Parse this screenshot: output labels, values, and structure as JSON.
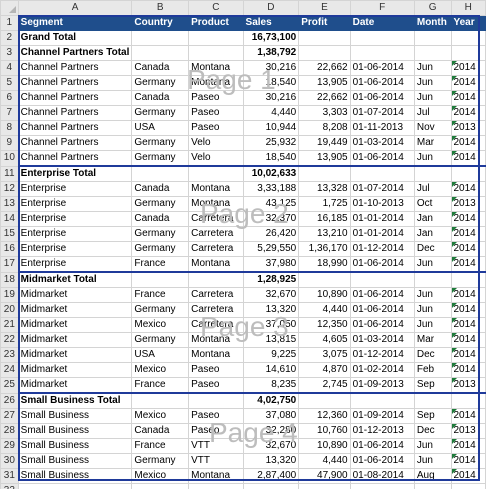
{
  "columns": [
    "A",
    "B",
    "C",
    "D",
    "E",
    "F",
    "G",
    "H"
  ],
  "header": [
    "Segment",
    "Country",
    "Product",
    "Sales",
    "Profit",
    "Date",
    "Month",
    "Year"
  ],
  "rows": [
    {
      "n": "2",
      "type": "total",
      "cells": [
        "Grand Total",
        "",
        "",
        "16,73,100",
        "",
        "",
        "",
        ""
      ]
    },
    {
      "n": "3",
      "type": "total",
      "cells": [
        "Channel Partners Total",
        "",
        "",
        "1,38,792",
        "",
        "",
        "",
        ""
      ]
    },
    {
      "n": "4",
      "type": "data",
      "cells": [
        "Channel Partners",
        "Canada",
        "Montana",
        "30,216",
        "22,662",
        "01-06-2014",
        "Jun",
        "2014"
      ]
    },
    {
      "n": "5",
      "type": "data",
      "cells": [
        "Channel Partners",
        "Germany",
        "Montana",
        "18,540",
        "13,905",
        "01-06-2014",
        "Jun",
        "2014"
      ]
    },
    {
      "n": "6",
      "type": "data",
      "cells": [
        "Channel Partners",
        "Canada",
        "Paseo",
        "30,216",
        "22,662",
        "01-06-2014",
        "Jun",
        "2014"
      ]
    },
    {
      "n": "7",
      "type": "data",
      "cells": [
        "Channel Partners",
        "Germany",
        "Paseo",
        "4,440",
        "3,303",
        "01-07-2014",
        "Jul",
        "2014"
      ]
    },
    {
      "n": "8",
      "type": "data",
      "cells": [
        "Channel Partners",
        "USA",
        "Paseo",
        "10,944",
        "8,208",
        "01-11-2013",
        "Nov",
        "2013"
      ]
    },
    {
      "n": "9",
      "type": "data",
      "cells": [
        "Channel Partners",
        "Germany",
        "Velo",
        "25,932",
        "19,449",
        "01-03-2014",
        "Mar",
        "2014"
      ]
    },
    {
      "n": "10",
      "type": "data",
      "cells": [
        "Channel Partners",
        "Germany",
        "Velo",
        "18,540",
        "13,905",
        "01-06-2014",
        "Jun",
        "2014"
      ]
    },
    {
      "n": "11",
      "type": "total",
      "cells": [
        "Enterprise Total",
        "",
        "",
        "10,02,633",
        "",
        "",
        "",
        ""
      ]
    },
    {
      "n": "12",
      "type": "data",
      "cells": [
        "Enterprise",
        "Canada",
        "Montana",
        "3,33,188",
        "13,328",
        "01-07-2014",
        "Jul",
        "2014"
      ]
    },
    {
      "n": "13",
      "type": "data",
      "cells": [
        "Enterprise",
        "Germany",
        "Montana",
        "43,125",
        "1,725",
        "01-10-2013",
        "Oct",
        "2013"
      ]
    },
    {
      "n": "14",
      "type": "data",
      "cells": [
        "Enterprise",
        "Canada",
        "Carretera",
        "32,370",
        "16,185",
        "01-01-2014",
        "Jan",
        "2014"
      ]
    },
    {
      "n": "15",
      "type": "data",
      "cells": [
        "Enterprise",
        "Germany",
        "Carretera",
        "26,420",
        "13,210",
        "01-01-2014",
        "Jan",
        "2014"
      ]
    },
    {
      "n": "16",
      "type": "data",
      "cells": [
        "Enterprise",
        "Germany",
        "Carretera",
        "5,29,550",
        "1,36,170",
        "01-12-2014",
        "Dec",
        "2014"
      ]
    },
    {
      "n": "17",
      "type": "data",
      "cells": [
        "Enterprise",
        "France",
        "Montana",
        "37,980",
        "18,990",
        "01-06-2014",
        "Jun",
        "2014"
      ]
    },
    {
      "n": "18",
      "type": "total",
      "cells": [
        "Midmarket Total",
        "",
        "",
        "1,28,925",
        "",
        "",
        "",
        ""
      ]
    },
    {
      "n": "19",
      "type": "data",
      "cells": [
        "Midmarket",
        "France",
        "Carretera",
        "32,670",
        "10,890",
        "01-06-2014",
        "Jun",
        "2014"
      ]
    },
    {
      "n": "20",
      "type": "data",
      "cells": [
        "Midmarket",
        "Germany",
        "Carretera",
        "13,320",
        "4,440",
        "01-06-2014",
        "Jun",
        "2014"
      ]
    },
    {
      "n": "21",
      "type": "data",
      "cells": [
        "Midmarket",
        "Mexico",
        "Carretera",
        "37,050",
        "12,350",
        "01-06-2014",
        "Jun",
        "2014"
      ]
    },
    {
      "n": "22",
      "type": "data",
      "cells": [
        "Midmarket",
        "Germany",
        "Montana",
        "13,815",
        "4,605",
        "01-03-2014",
        "Mar",
        "2014"
      ]
    },
    {
      "n": "23",
      "type": "data",
      "cells": [
        "Midmarket",
        "USA",
        "Montana",
        "9,225",
        "3,075",
        "01-12-2014",
        "Dec",
        "2014"
      ]
    },
    {
      "n": "24",
      "type": "data",
      "cells": [
        "Midmarket",
        "Mexico",
        "Paseo",
        "14,610",
        "4,870",
        "01-02-2014",
        "Feb",
        "2014"
      ]
    },
    {
      "n": "25",
      "type": "data",
      "cells": [
        "Midmarket",
        "France",
        "Paseo",
        "8,235",
        "2,745",
        "01-09-2013",
        "Sep",
        "2013"
      ]
    },
    {
      "n": "26",
      "type": "total",
      "cells": [
        "Small Business Total",
        "",
        "",
        "4,02,750",
        "",
        "",
        "",
        ""
      ]
    },
    {
      "n": "27",
      "type": "data",
      "cells": [
        "Small Business",
        "Mexico",
        "Paseo",
        "37,080",
        "12,360",
        "01-09-2014",
        "Sep",
        "2014"
      ]
    },
    {
      "n": "28",
      "type": "data",
      "cells": [
        "Small Business",
        "Canada",
        "Paseo",
        "32,280",
        "10,760",
        "01-12-2013",
        "Dec",
        "2013"
      ]
    },
    {
      "n": "29",
      "type": "data",
      "cells": [
        "Small Business",
        "France",
        "VTT",
        "32,670",
        "10,890",
        "01-06-2014",
        "Jun",
        "2014"
      ]
    },
    {
      "n": "30",
      "type": "data",
      "cells": [
        "Small Business",
        "Germany",
        "VTT",
        "13,320",
        "4,440",
        "01-06-2014",
        "Jun",
        "2014"
      ]
    },
    {
      "n": "31",
      "type": "data",
      "cells": [
        "Small Business",
        "Mexico",
        "Montana",
        "2,87,400",
        "47,900",
        "01-08-2014",
        "Aug",
        "2014"
      ]
    },
    {
      "n": "32",
      "type": "blank",
      "cells": [
        "",
        "",
        "",
        "",
        "",
        "",
        "",
        ""
      ]
    }
  ],
  "header_row_number": "1",
  "page_marks": [
    "Page 1",
    "Page 2",
    "Page 3",
    "Page 4"
  ],
  "colors": {
    "header_fill": "#1f4e8c",
    "page_border": "#1f3a9a",
    "watermark": "#bdbdbd",
    "triangle": "#1e7b3a"
  }
}
